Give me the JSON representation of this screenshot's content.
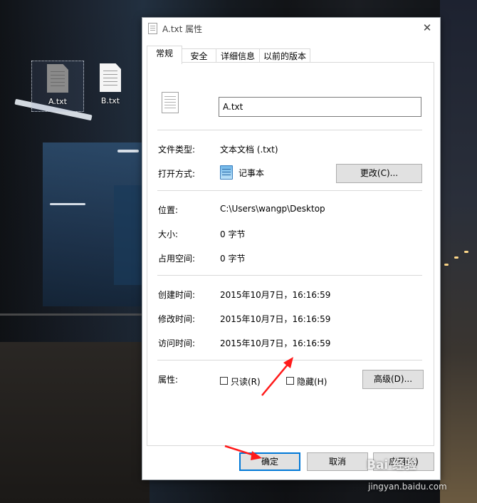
{
  "desktop": {
    "icons": [
      {
        "label": "A.txt",
        "selected": true
      },
      {
        "label": "B.txt",
        "selected": false
      }
    ]
  },
  "dialog": {
    "title": "A.txt 属性",
    "close_icon": "close-icon",
    "tabs": [
      "常规",
      "安全",
      "详细信息",
      "以前的版本"
    ],
    "active_tab": "常规",
    "file_name": "A.txt",
    "rows": {
      "type_label": "文件类型:",
      "type_value": "文本文档 (.txt)",
      "open_label": "打开方式:",
      "open_value": "记事本",
      "change_button": "更改(C)...",
      "location_label": "位置:",
      "location_value": "C:\\Users\\wangp\\Desktop",
      "size_label": "大小:",
      "size_value": "0 字节",
      "disk_label": "占用空间:",
      "disk_value": "0 字节",
      "created_label": "创建时间:",
      "created_value": "2015年10月7日，16:16:59",
      "modified_label": "修改时间:",
      "modified_value": "2015年10月7日，16:16:59",
      "accessed_label": "访问时间:",
      "accessed_value": "2015年10月7日，16:16:59",
      "attr_label": "属性:",
      "readonly_label": "只读(R)",
      "readonly_checked": false,
      "hidden_label": "隐藏(H)",
      "hidden_checked": false,
      "advanced_button": "高级(D)..."
    },
    "buttons": {
      "ok": "确定",
      "cancel": "取消",
      "apply": "应用(A)"
    }
  },
  "annotations": {
    "arrow_color": "#ff1a1a"
  },
  "watermark": {
    "brand": "Bai 经验",
    "url": "jingyan.baidu.com"
  }
}
